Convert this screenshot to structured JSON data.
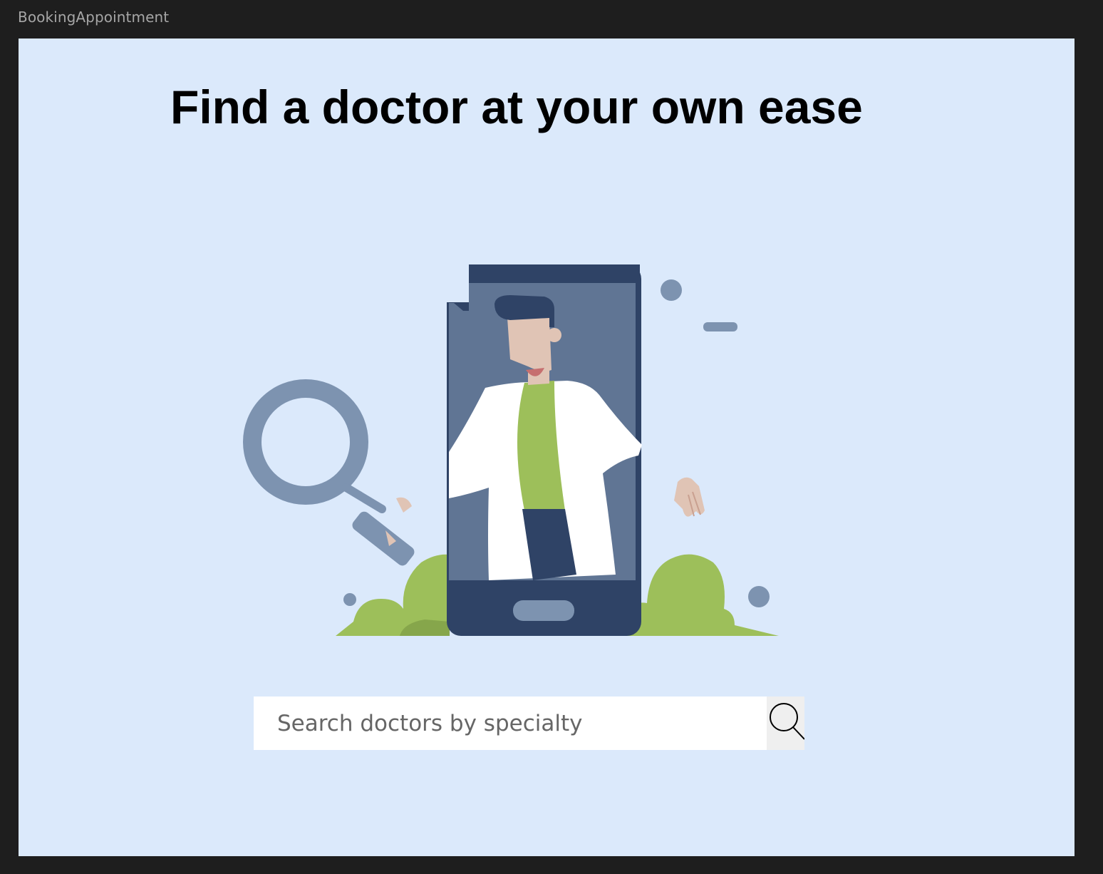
{
  "window": {
    "frame_title": "BookingAppointment"
  },
  "hero": {
    "headline": "Find a doctor at your own ease",
    "illustration_icon": "doctor-on-phone-illustration"
  },
  "search": {
    "placeholder": "Search doctors by specialty",
    "value": "",
    "button_icon": "search-icon"
  },
  "colors": {
    "frame_background": "#1e1e1e",
    "canvas_background": "#dbe9fb",
    "phone_dark": "#2f4366",
    "phone_screen": "#607594",
    "accent_grey_blue": "#7d93b0",
    "bush_green": "#9dbf5a",
    "shirt_green": "#9dbf5a",
    "search_button_bg": "#efefef"
  }
}
